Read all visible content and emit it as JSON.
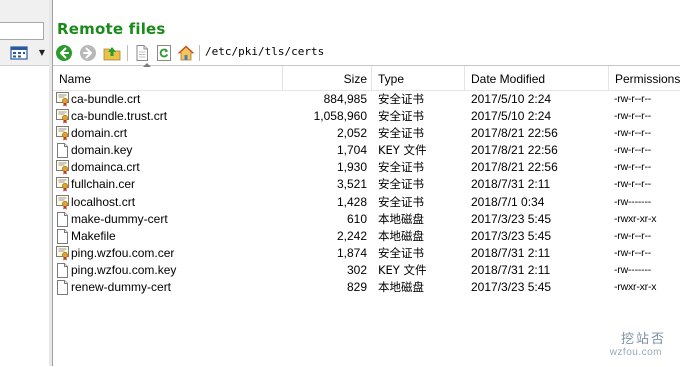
{
  "remote": {
    "title": "Remote files",
    "path": "/etc/pki/tls/certs",
    "toolbar": [
      {
        "name": "back-icon",
        "color": "#2e9a2e"
      },
      {
        "name": "forward-icon",
        "color": "#9a9a9a"
      },
      {
        "name": "parent-folder-icon",
        "color": "#d8b13a"
      },
      {
        "name": "new-file-icon",
        "color": "#8a8a8a"
      },
      {
        "name": "refresh-icon",
        "color": "#2e9a2e"
      },
      {
        "name": "home-icon",
        "color": "#d26a2a"
      }
    ]
  },
  "columns": {
    "name": "Name",
    "size": "Size",
    "type": "Type",
    "date": "Date Modified",
    "perm": "Permissions"
  },
  "files": [
    {
      "icon": "certificate-icon",
      "name": "ca-bundle.crt",
      "size": "884,985",
      "type": "安全证书",
      "date": "2017/5/10 2:24",
      "perm": "-rw-r--r--"
    },
    {
      "icon": "certificate-icon",
      "name": "ca-bundle.trust.crt",
      "size": "1,058,960",
      "type": "安全证书",
      "date": "2017/5/10 2:24",
      "perm": "-rw-r--r--"
    },
    {
      "icon": "certificate-icon",
      "name": "domain.crt",
      "size": "2,052",
      "type": "安全证书",
      "date": "2017/8/21 22:56",
      "perm": "-rw-r--r--"
    },
    {
      "icon": "file-icon",
      "name": "domain.key",
      "size": "1,704",
      "type": "KEY 文件",
      "date": "2017/8/21 22:56",
      "perm": "-rw-r--r--"
    },
    {
      "icon": "certificate-icon",
      "name": "domainca.crt",
      "size": "1,930",
      "type": "安全证书",
      "date": "2017/8/21 22:56",
      "perm": "-rw-r--r--"
    },
    {
      "icon": "certificate-icon",
      "name": "fullchain.cer",
      "size": "3,521",
      "type": "安全证书",
      "date": "2018/7/31 2:11",
      "perm": "-rw-r--r--"
    },
    {
      "icon": "certificate-icon",
      "name": "localhost.crt",
      "size": "1,428",
      "type": "安全证书",
      "date": "2018/7/1 0:34",
      "perm": "-rw-------"
    },
    {
      "icon": "file-icon",
      "name": "make-dummy-cert",
      "size": "610",
      "type": "本地磁盘",
      "date": "2017/3/23 5:45",
      "perm": "-rwxr-xr-x"
    },
    {
      "icon": "file-icon",
      "name": "Makefile",
      "size": "2,242",
      "type": "本地磁盘",
      "date": "2017/3/23 5:45",
      "perm": "-rw-r--r--"
    },
    {
      "icon": "certificate-icon",
      "name": "ping.wzfou.com.cer",
      "size": "1,874",
      "type": "安全证书",
      "date": "2018/7/31 2:11",
      "perm": "-rw-r--r--"
    },
    {
      "icon": "file-icon",
      "name": "ping.wzfou.com.key",
      "size": "302",
      "type": "KEY 文件",
      "date": "2018/7/31 2:11",
      "perm": "-rw-------"
    },
    {
      "icon": "file-icon",
      "name": "renew-dummy-cert",
      "size": "829",
      "type": "本地磁盘",
      "date": "2017/3/23 5:45",
      "perm": "-rwxr-xr-x"
    }
  ],
  "watermark": {
    "logo_text": "挖站否",
    "domain": "wzfou.com"
  }
}
